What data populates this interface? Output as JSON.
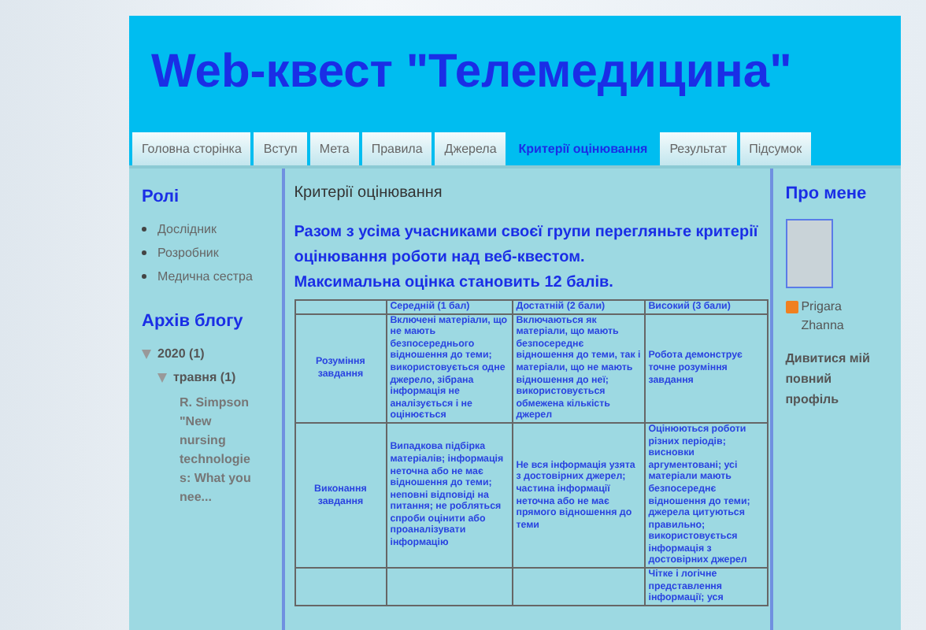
{
  "header": {
    "title": "Web-квест \"Телемедицина\""
  },
  "tabs": [
    {
      "label": "Головна сторінка",
      "selected": false
    },
    {
      "label": "Вступ",
      "selected": false
    },
    {
      "label": "Мета",
      "selected": false
    },
    {
      "label": "Правила",
      "selected": false
    },
    {
      "label": "Джерела",
      "selected": false
    },
    {
      "label": "Критерії оцінювання",
      "selected": true
    },
    {
      "label": "Результат",
      "selected": false
    },
    {
      "label": "Підсумок",
      "selected": false
    }
  ],
  "sidebar": {
    "roles_title": "Ролі",
    "roles": [
      "Дослідник",
      "Розробник",
      "Медична сестра"
    ],
    "archive_title": "Архів блогу",
    "archive": [
      {
        "label": "2020",
        "count": "(1)",
        "expanded": true,
        "children": [
          {
            "label": "травня",
            "count": "(1)",
            "expanded": true,
            "posts": [
              "R. Simpson \"New nursing technologie s: What you nee..."
            ]
          }
        ]
      }
    ]
  },
  "post": {
    "title": "Критерії оцінювання",
    "intro": "Разом з усіма учасниками своєї групи перегляньте критерії оцінювання роботи над веб-квестом.",
    "max_score": "Максимальна оцінка становить 12 балів.",
    "table": {
      "columns": [
        "",
        "Середній (1 бал)",
        "Достатній (2 бали)",
        "Високий (3 бали)"
      ],
      "rows": [
        [
          "Розуміння завдання",
          "Включені матеріали, що не мають безпосереднього відношення до теми; використовується одне джерело, зібрана інформація не аналізується і не оцінюється",
          "Включаються як матеріали, що мають безпосереднє відношення до теми, так і матеріали, що не мають відношення до неї; використовується обмежена кількість джерел",
          "Робота демонструє точне розуміння завдання"
        ],
        [
          "Виконання завдання",
          "Випадкова підбірка матеріалів; інформація неточна або не має відношення до теми; неповні відповіді на питання; не робляться спроби оцінити або проаналізувати інформацію",
          "Не вся інформація узята з достовірних джерел; частина інформації неточна або не має прямого відношення до теми",
          "Оцінюються роботи різних періодів; висновки аргументовані; усі матеріали мають безпосереднє відношення до теми; джерела цитуються правильно; використовується інформація з достовірних джерел"
        ],
        [
          "",
          "",
          "",
          "Чітке і логічне представлення інформації; уся"
        ]
      ]
    }
  },
  "about": {
    "title": "Про мене",
    "name": "Prigara Zhanna",
    "profile_link": "Дивитися мій повний профіль"
  }
}
